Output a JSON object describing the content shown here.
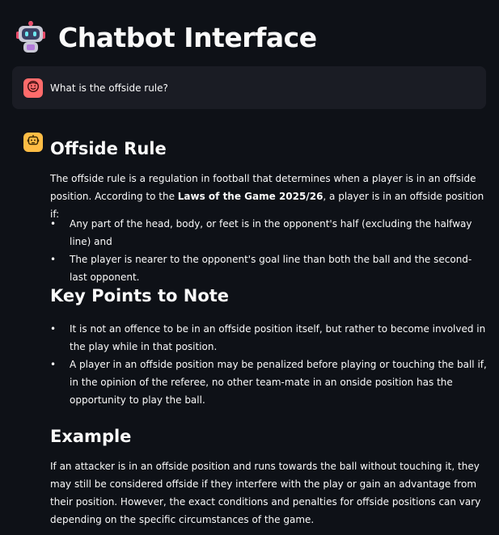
{
  "app": {
    "title": "Chatbot Interface",
    "title_icon": "robot-icon"
  },
  "user_message": {
    "avatar_icon": "smiling-face-icon",
    "avatar_color": "#ff6b6b",
    "text": "What is the offside rule?"
  },
  "assistant_message": {
    "avatar_icon": "bot-face-icon",
    "avatar_color": "#ffbd45",
    "heading_1": "Offside Rule",
    "intro_start": "The offside rule is a regulation in football that determines when a player is in an offside position. According to the ",
    "intro_bold": "Laws of the Game 2025/26",
    "intro_end": ", a player is in an offside position if:",
    "conditions": [
      "Any part of the head, body, or feet is in the opponent's half (excluding the halfway line) and",
      "The player is nearer to the opponent's goal line than both the ball and the second-last opponent."
    ],
    "heading_2": "Key Points to Note",
    "key_points": [
      "It is not an offence to be in an offside position itself, but rather to become involved in the play while in that position.",
      "A player in an offside position may be penalized before playing or touching the ball if, in the opinion of the referee, no other team-mate in an onside position has the opportunity to play the ball."
    ],
    "heading_3": "Example",
    "example_text": "If an attacker is in an offside position and runs towards the ball without touching it, they may still be considered offside if they interfere with the play or gain an advantage from their position. However, the exact conditions and penalties for offside positions can vary depending on the specific circumstances of the game."
  },
  "colors": {
    "background": "#0e1117",
    "user_bubble": "#1a1c24",
    "text": "#fafafa"
  }
}
